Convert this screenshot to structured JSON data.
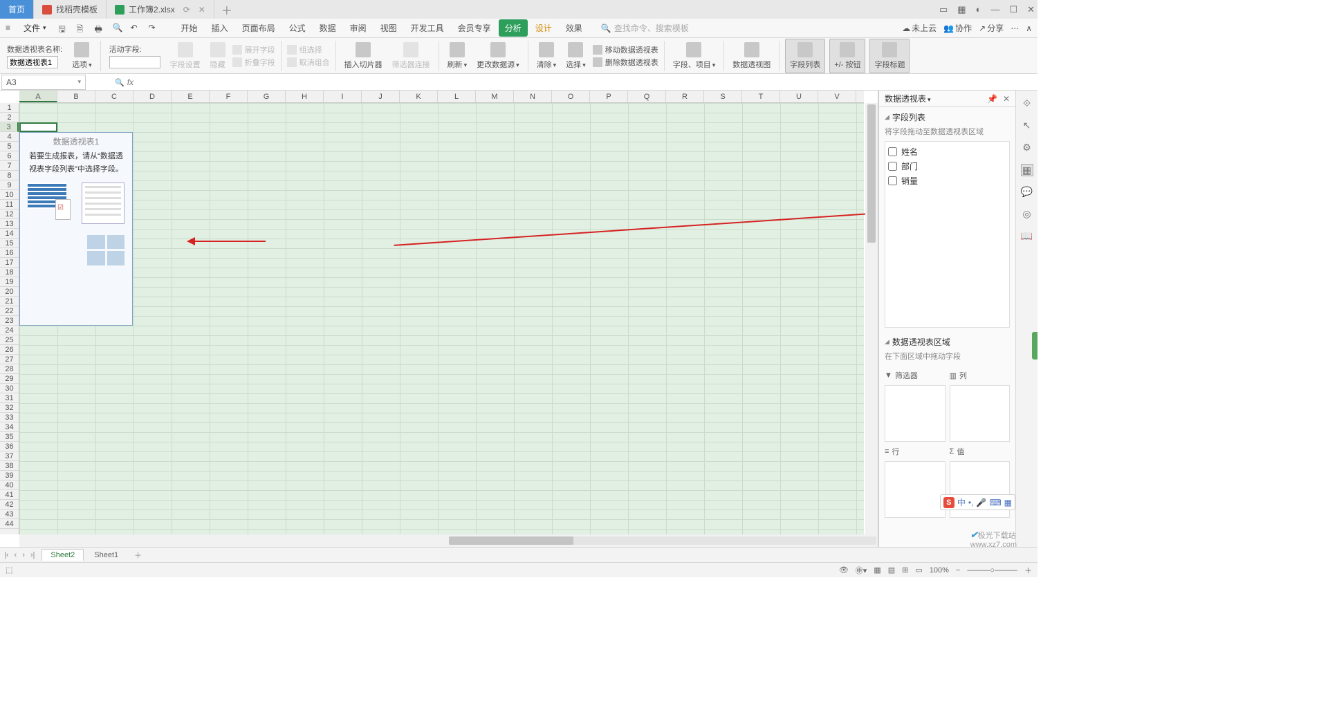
{
  "titlebar": {
    "home": "首页",
    "tab_template": "找稻壳模板",
    "tab_workbook": "工作簿2.xlsx"
  },
  "menu": {
    "file": "文件",
    "tabs": {
      "start": "开始",
      "insert": "插入",
      "layout": "页面布局",
      "formula": "公式",
      "data": "数据",
      "review": "审阅",
      "view": "视图",
      "dev": "开发工具",
      "member": "会员专享",
      "analyze": "分析",
      "design": "设计",
      "effect": "效果"
    },
    "search_ph": "查找命令、搜索模板",
    "right": {
      "cloud": "未上云",
      "collab": "协作",
      "share": "分享"
    }
  },
  "ribbon": {
    "pvname_label": "数据透视表名称:",
    "pvname_value": "数据透视表1",
    "options": "选项",
    "active_field": "活动字段:",
    "field_settings": "字段设置",
    "hide": "隐藏",
    "collapse_field": "折叠字段",
    "expand_field": "展开字段",
    "group_select": "组选择",
    "ungroup": "取消组合",
    "insert_slicer": "插入切片器",
    "filter_conn": "筛选器连接",
    "refresh": "刷新",
    "change_source": "更改数据源",
    "clear": "清除",
    "select": "选择",
    "move_pivot": "移动数据透视表",
    "delete_pivot": "删除数据透视表",
    "fields": "字段、项目",
    "pivot_chart": "数据透视图",
    "field_list": "字段列表",
    "pm_buttons": "+/- 按钮",
    "field_headers": "字段标题"
  },
  "namebox": "A3",
  "pivot_placeholder": {
    "title": "数据透视表1",
    "hint1": "若要生成报表，请从“数据透",
    "hint2": "视表字段列表”中选择字段。"
  },
  "pvpane": {
    "title": "数据透视表",
    "sec_fields": "字段列表",
    "fields_hint": "将字段拖动至数据透视表区域",
    "fields": [
      "姓名",
      "部门",
      "销量"
    ],
    "sec_areas": "数据透视表区域",
    "areas_hint": "在下面区域中拖动字段",
    "filter": "筛选器",
    "column": "列",
    "row": "行",
    "value": "值"
  },
  "columns": [
    "A",
    "B",
    "C",
    "D",
    "E",
    "F",
    "G",
    "H",
    "I",
    "J",
    "K",
    "L",
    "M",
    "N",
    "O",
    "P",
    "Q",
    "R",
    "S",
    "T",
    "U",
    "V"
  ],
  "sheets": {
    "active": "Sheet2",
    "other": "Sheet1"
  },
  "status": {
    "zoom": "100%"
  },
  "ime": {
    "mode": "中"
  },
  "watermark": {
    "brand": "极光下载站",
    "url": "www.xz7.com"
  }
}
